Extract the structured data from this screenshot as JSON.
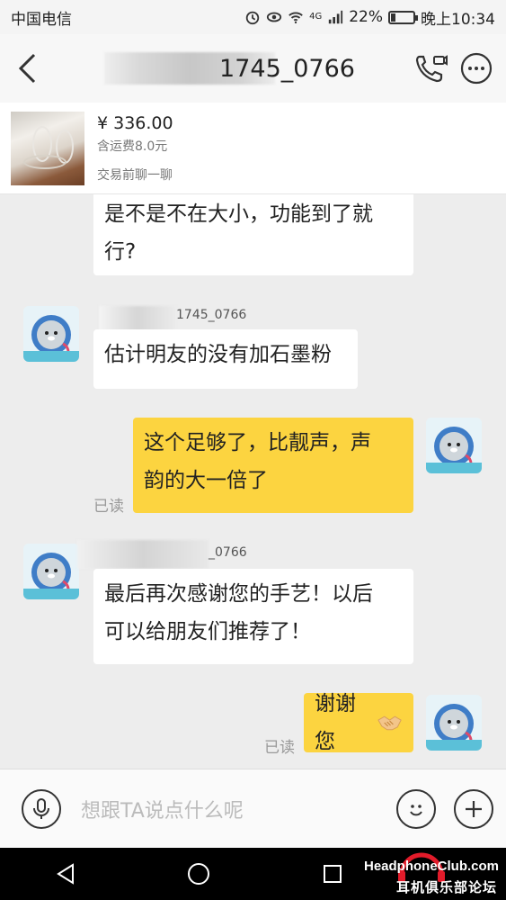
{
  "status_bar": {
    "carrier": "中国电信",
    "battery": "22%",
    "battery_level": 0.22,
    "time": "晚上10:34",
    "network": "4G"
  },
  "header": {
    "title": "1745_0766",
    "icons": [
      "back-icon",
      "voice-call-icon",
      "more-icon"
    ]
  },
  "product": {
    "price": "¥ 336.00",
    "shipping": "含运费8.0元",
    "pre_chat": "交易前聊一聊"
  },
  "messages": [
    {
      "direction": "in",
      "text_lines": [
        "是不是不在大小，功能到了就",
        "行?"
      ]
    },
    {
      "direction": "in",
      "sender": "1745_0766",
      "text_lines": [
        "估计明友的没有加石墨粉"
      ]
    },
    {
      "direction": "out",
      "read": "已读",
      "text_lines": [
        "这个足够了，比靓声，声",
        "韵的大一倍了"
      ]
    },
    {
      "direction": "in",
      "sender": "_0766",
      "text_lines": [
        "最后再次感谢您的手艺！以后",
        "可以给朋友们推荐了！"
      ]
    },
    {
      "direction": "out",
      "read": "已读",
      "text_lines": [
        "谢谢您"
      ],
      "emoji": "handshake-icon"
    }
  ],
  "input": {
    "placeholder": "想跟TA说点什么呢",
    "icons": [
      "microphone-icon",
      "emoji-icon",
      "plus-icon"
    ]
  },
  "nav": {
    "icons": [
      "back-triangle-icon",
      "home-circle-icon",
      "recents-square-icon"
    ]
  },
  "watermark": {
    "line1": "HeadphoneClub.com",
    "line2": "耳机俱乐部论坛"
  },
  "colors": {
    "outgoing_bubble": "#fcd440",
    "incoming_bubble": "#ffffff",
    "chat_background": "#ededed"
  }
}
